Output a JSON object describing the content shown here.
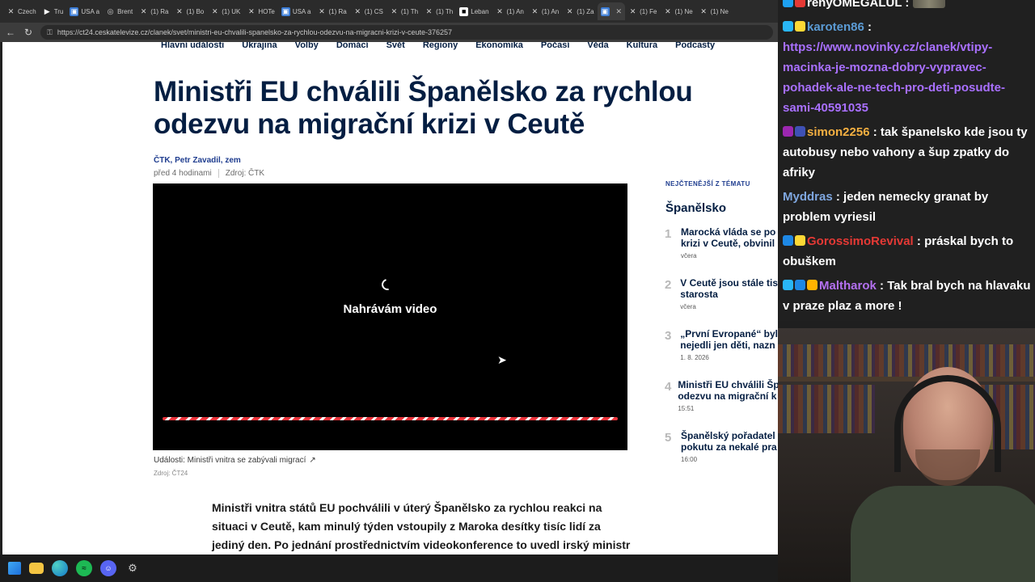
{
  "browser": {
    "tabs": [
      {
        "label": "Czech",
        "icon": "x-icon"
      },
      {
        "label": "Tru",
        "icon": "play-icon"
      },
      {
        "label": "USA a",
        "icon": "ct24-icon"
      },
      {
        "label": "Brent",
        "icon": "globe-icon"
      },
      {
        "label": "(1) Ra",
        "icon": "x-icon"
      },
      {
        "label": "(1) Bo",
        "icon": "x-icon"
      },
      {
        "label": "(1) UK",
        "icon": "x-icon"
      },
      {
        "label": "HOTe",
        "icon": "x-icon"
      },
      {
        "label": "USA a",
        "icon": "ct24-icon"
      },
      {
        "label": "(1) Ra",
        "icon": "x-icon"
      },
      {
        "label": "(1) CS",
        "icon": "x-icon"
      },
      {
        "label": "(1) Th",
        "icon": "x-icon"
      },
      {
        "label": "(1) Th",
        "icon": "x-icon"
      },
      {
        "label": "Leban",
        "icon": "site-icon"
      },
      {
        "label": "(1) An",
        "icon": "x-icon"
      },
      {
        "label": "(1) An",
        "icon": "x-icon"
      },
      {
        "label": "(1) Za",
        "icon": "x-icon"
      },
      {
        "label": "",
        "icon": "ct24-icon",
        "active": true
      },
      {
        "label": "(1) Fe",
        "icon": "x-icon"
      },
      {
        "label": "(1) Ne",
        "icon": "x-icon"
      },
      {
        "label": "(1) Ne",
        "icon": "x-icon"
      }
    ],
    "url": "https://ct24.ceskatelevize.cz/clanek/svet/ministri-eu-chvalili-spanelsko-za-rychlou-odezvu-na-migracni-krizi-v-ceute-376257"
  },
  "page": {
    "nav": [
      "Hlavní události",
      "Ukrajina",
      "Volby",
      "Domácí",
      "Svět",
      "Regiony",
      "Ekonomika",
      "Počasí",
      "Věda",
      "Kultura",
      "Podcasty"
    ],
    "headline": "Ministři EU chválili Španělsko za rychlou odezvu na migrační krizi v Ceutě",
    "authors": "ČTK, Petr Zavadil, zem",
    "time": "před 4 hodinami",
    "source": "Zdroj: ČTK",
    "video": {
      "loading_text": "Nahrávám video"
    },
    "video_caption": "Události: Ministři vnitra se zabývali migrací",
    "video_source": "Zdroj: ČT24",
    "body": "Ministři vnitra států EU pochválili v úterý Španělsko za rychlou reakci na situaci v Ceutě, kam minulý týden vstoupily z Maroka desítky tisíc lidí za jediný den. Po jednání prostřednictvím videokonference to uvedl irský ministr spravedlnosti a",
    "sidebar": {
      "label": "NEJČTENĚJŠÍ Z TÉMATU",
      "title": "Španělsko",
      "items": [
        {
          "num": "1",
          "title": "Marocká vláda se po\nkrizi v Ceutě, obvinil",
          "time": "včera"
        },
        {
          "num": "2",
          "title": "V Ceutě jsou stále tis\nstarosta",
          "time": "včera"
        },
        {
          "num": "3",
          "title": "„První Evropané“ byl\nnejedli jen děti, nazn",
          "time": "1. 8. 2026"
        },
        {
          "num": "4",
          "title": "Ministři EU chválili Šp\nodezvu na migrační k",
          "time": "15:51"
        },
        {
          "num": "5",
          "title": "Španělský pořadatel\npokutu za nekalé pra",
          "time": "16:00"
        }
      ]
    }
  },
  "chat": {
    "messages": [
      {
        "user": "renyOMEGALUL",
        "user_color": "#ffffff",
        "text": "",
        "badges": [
          "#1da1f2",
          "#e53935"
        ],
        "emote": true
      },
      {
        "user": "karoten86",
        "user_color": "#5b9bd5",
        "text": "",
        "badges": [
          "#29b6f6",
          "#fdd835"
        ],
        "link": "https://www.novinky.cz/clanek/vtipy-macinka-je-mozna-dobry-vypravec-pohadek-ale-ne-tech-pro-deti-posudte-sami-40591035"
      },
      {
        "user": "simon2256",
        "user_color": "#f5b041",
        "text": "tak španelsko kde jsou ty autobusy nebo vahony a šup zpatky do afriky",
        "badges": [
          "#9c27b0",
          "#3f51b5"
        ]
      },
      {
        "user": "Myddras",
        "user_color": "#7fa7e0",
        "text": "jeden nemecky granat by problem vyriesil",
        "badges": []
      },
      {
        "user": "GorossimoRevival",
        "user_color": "#e53935",
        "text": "práskal bych to obuškem",
        "badges": [
          "#1e88e5",
          "#fdd835"
        ]
      },
      {
        "user": "Maltharok",
        "user_color": "#b370f0",
        "text": "Tak bral bych na hlavaku v praze plaz a more !",
        "badges": [
          "#29b6f6",
          "#1e88e5",
          "#ffb300"
        ]
      }
    ]
  },
  "taskbar": {
    "icons": [
      "windows-start-icon",
      "file-explorer-icon",
      "edge-icon",
      "spotify-icon",
      "discord-icon",
      "settings-icon"
    ]
  }
}
